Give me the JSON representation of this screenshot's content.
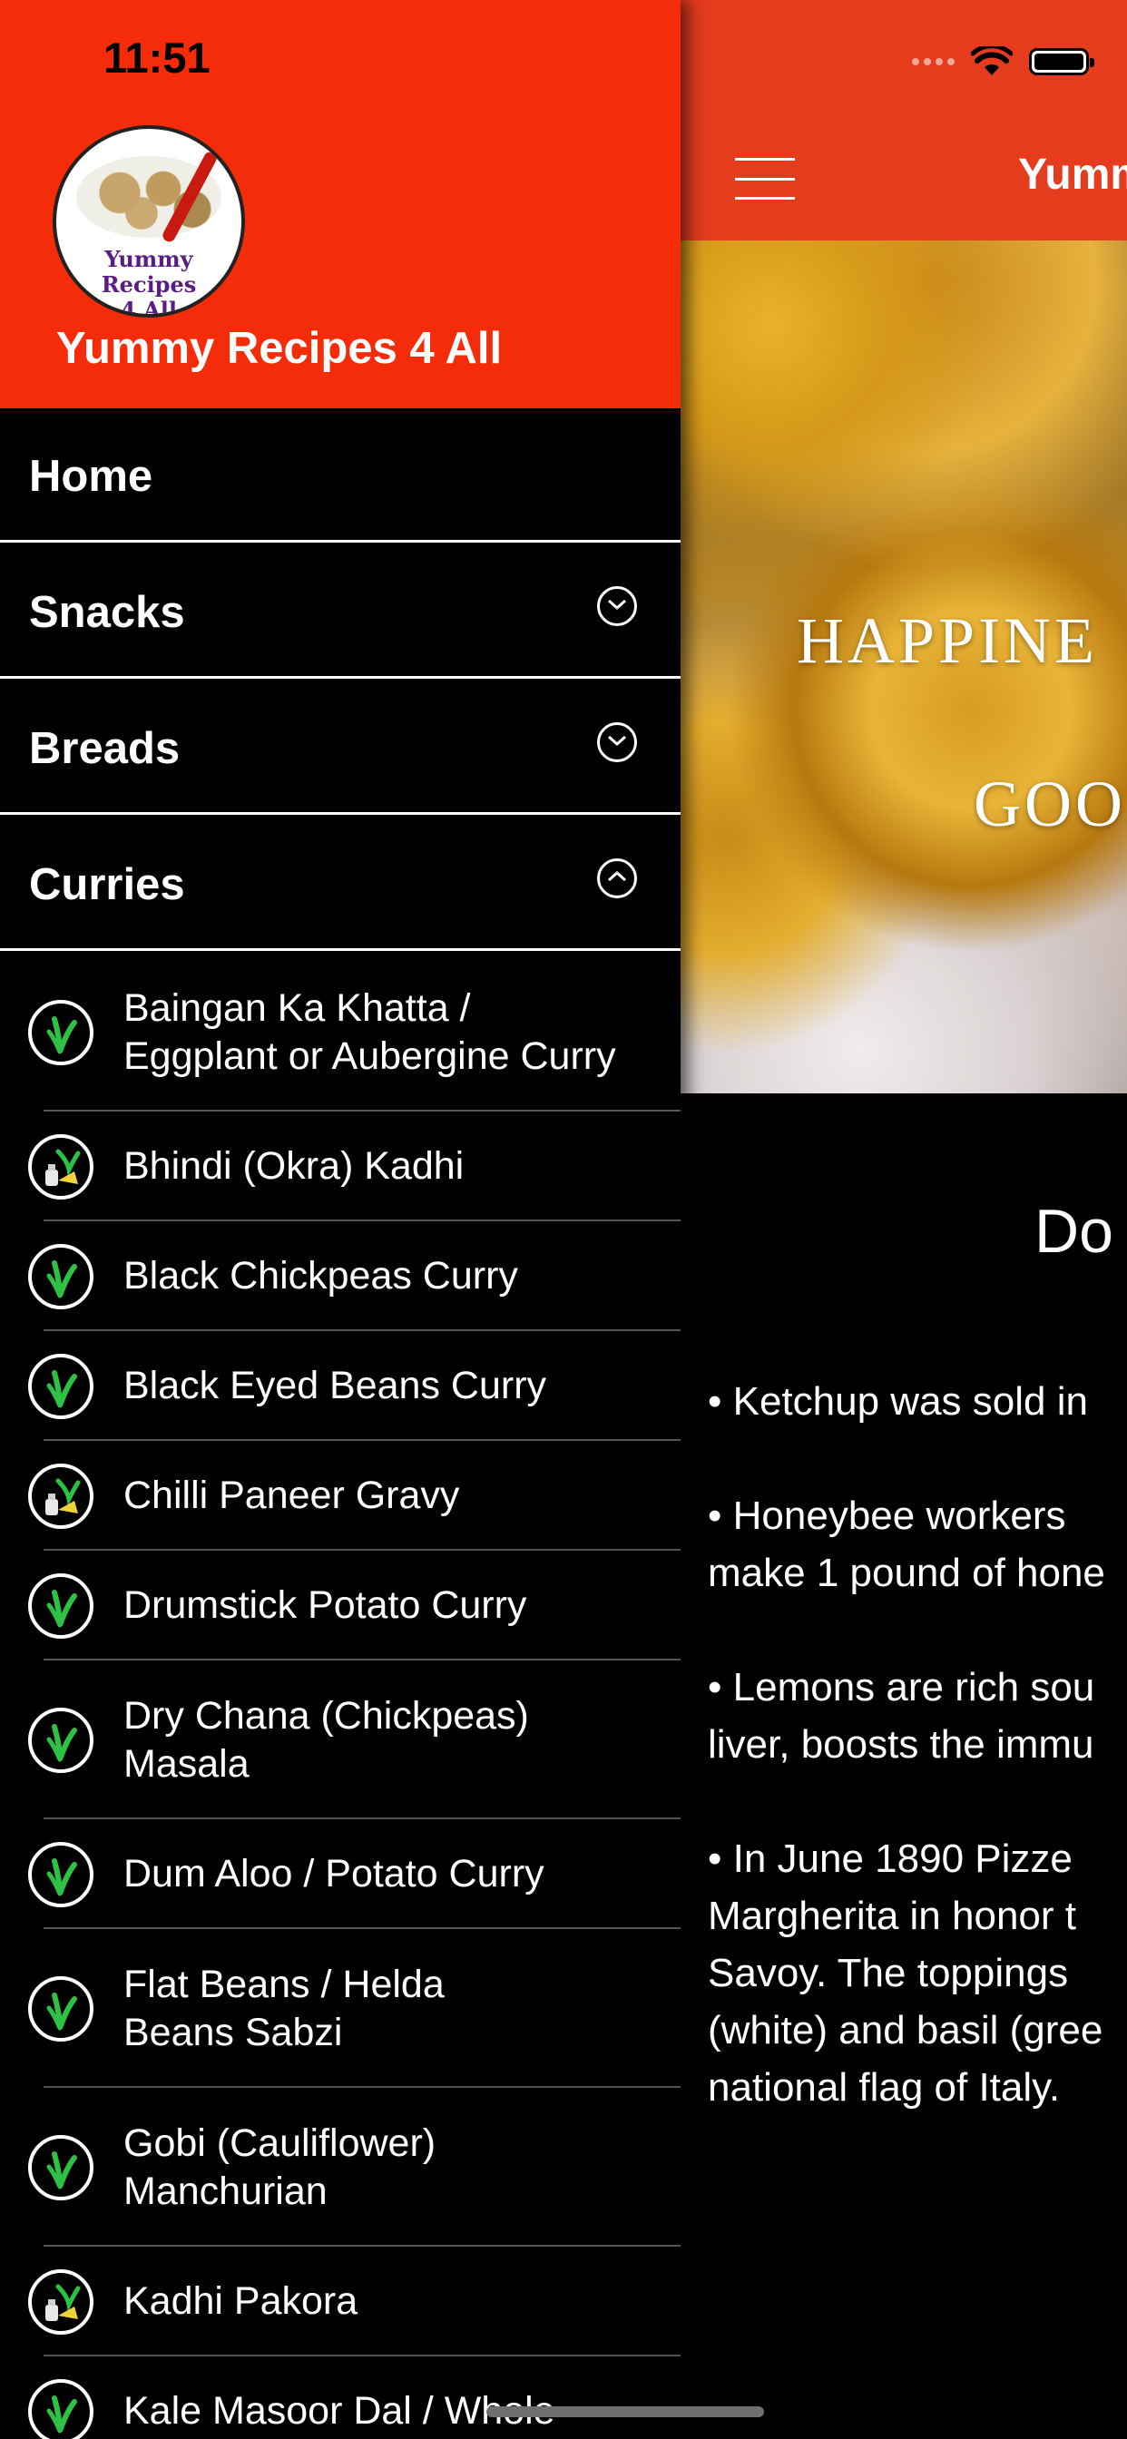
{
  "status_bar": {
    "time": "11:51"
  },
  "drawer": {
    "app_name": "Yummy Recipes 4 All",
    "logo_text_line1": "Yummy Recipes",
    "logo_text_line2": "4 All",
    "nav": [
      {
        "label": "Home",
        "expandable": false
      },
      {
        "label": "Snacks",
        "expandable": true,
        "expanded": false
      },
      {
        "label": "Breads",
        "expandable": true,
        "expanded": false
      },
      {
        "label": "Curries",
        "expandable": true,
        "expanded": true
      }
    ],
    "curries": [
      {
        "line1": "Baingan Ka Khatta /",
        "line2": "Eggplant or Aubergine Curry",
        "icon": "vegan-icon"
      },
      {
        "line1": "Bhindi (Okra) Kadhi",
        "line2": "",
        "icon": "vegetarian-dairy-icon"
      },
      {
        "line1": "Black Chickpeas Curry",
        "line2": "",
        "icon": "vegan-icon"
      },
      {
        "line1": "Black Eyed Beans Curry",
        "line2": "",
        "icon": "vegan-icon"
      },
      {
        "line1": "Chilli Paneer Gravy",
        "line2": "",
        "icon": "vegetarian-dairy-icon"
      },
      {
        "line1": "Drumstick Potato Curry",
        "line2": "",
        "icon": "vegan-icon"
      },
      {
        "line1": "Dry Chana (Chickpeas)",
        "line2": "Masala",
        "icon": "vegan-icon"
      },
      {
        "line1": "Dum Aloo / Potato Curry",
        "line2": "",
        "icon": "vegan-icon"
      },
      {
        "line1": "Flat Beans / Helda",
        "line2": "Beans Sabzi",
        "icon": "vegan-icon"
      },
      {
        "line1": "Gobi (Cauliflower)",
        "line2": "Manchurian",
        "icon": "vegan-icon"
      },
      {
        "line1": "Kadhi Pakora",
        "line2": "",
        "icon": "vegetarian-dairy-icon"
      },
      {
        "line1": "Kale Masoor Dal / Whole",
        "line2": "",
        "icon": "vegan-icon"
      }
    ]
  },
  "main": {
    "title": "Yumm",
    "banner_line1": "HAPPINE",
    "banner_line2": "GOO",
    "section_title": "Do",
    "facts": [
      [
        "• Ketchup was sold in"
      ],
      [
        "• Honeybee workers",
        "make 1 pound of hone"
      ],
      [
        "• Lemons are rich sou",
        "liver, boosts the immu"
      ],
      [
        "• In June 1890 Pizze",
        "Margherita in honor t",
        "Savoy. The toppings",
        "(white) and basil (gree",
        "national flag of Italy."
      ]
    ]
  }
}
